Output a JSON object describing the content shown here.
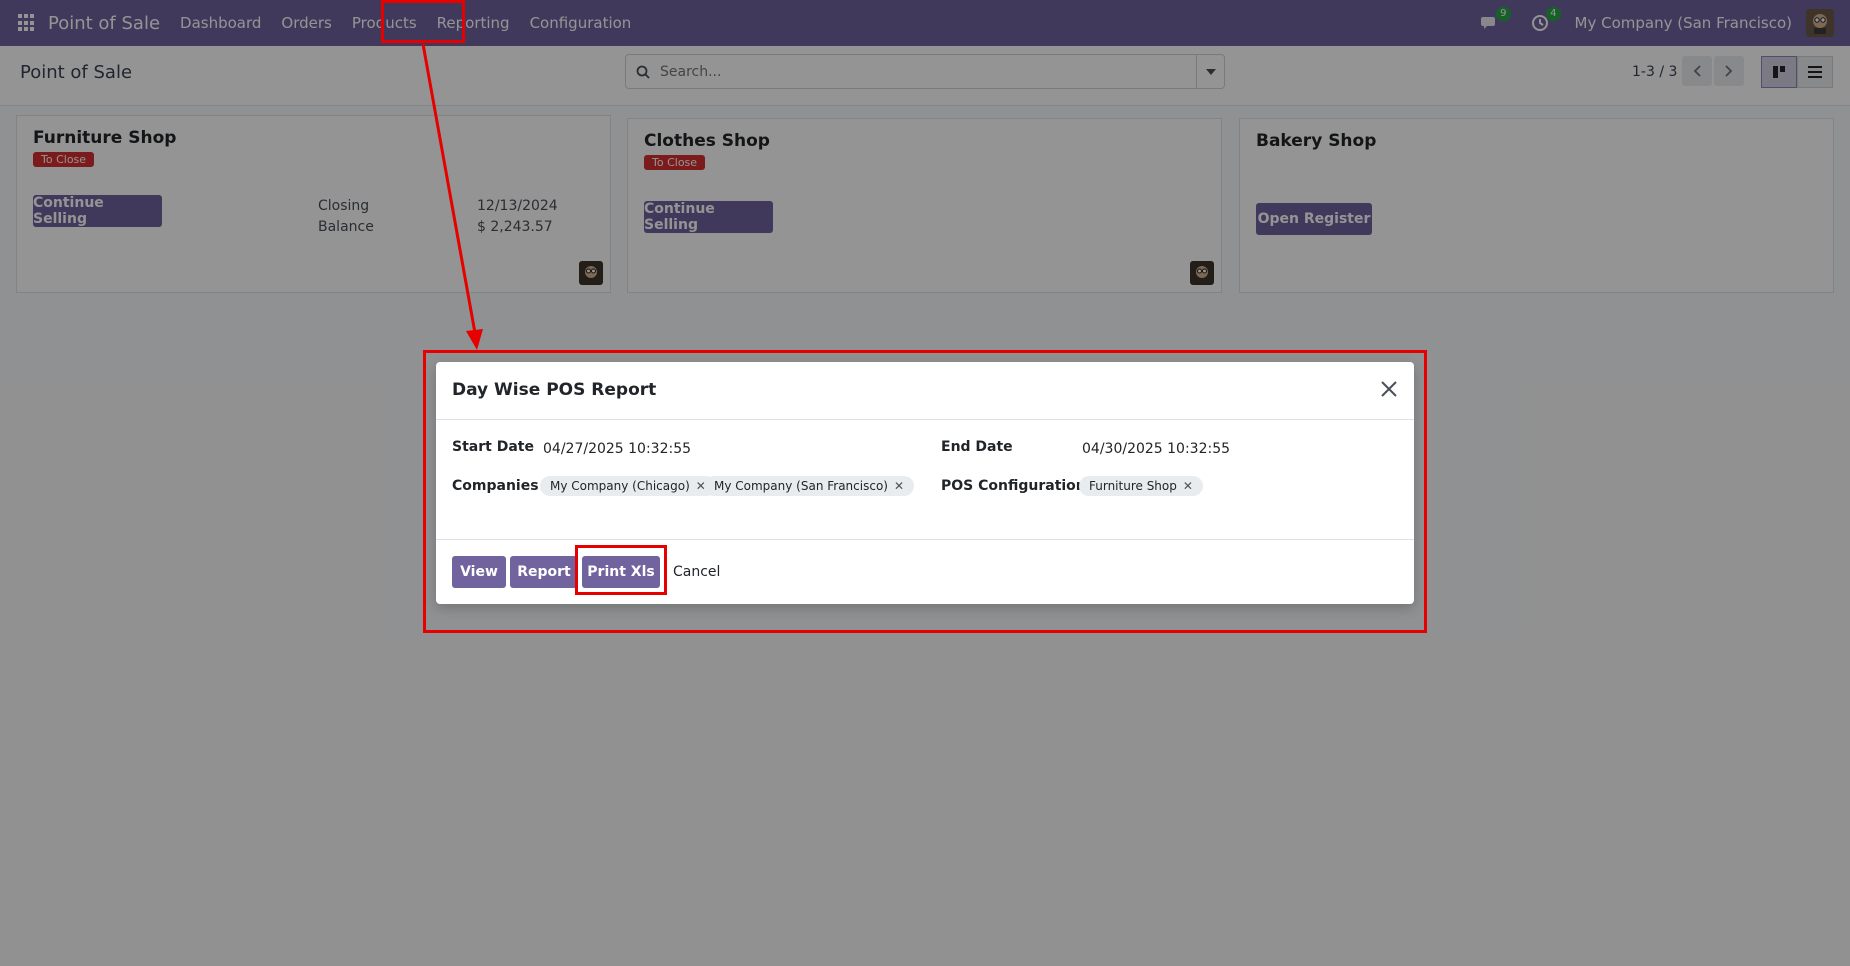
{
  "navbar": {
    "brand": "Point of Sale",
    "menu": [
      "Dashboard",
      "Orders",
      "Products",
      "Reporting",
      "Configuration"
    ],
    "messages_count": "9",
    "activities_count": "4",
    "company": "My Company (San Francisco)"
  },
  "control_panel": {
    "breadcrumb": "Point of Sale",
    "search_placeholder": "Search...",
    "pager": "1-3 / 3"
  },
  "cards": [
    {
      "title": "Furniture Shop",
      "status": "To Close",
      "button": "Continue Selling",
      "closing_label": "Closing",
      "closing_value": "12/13/2024",
      "balance_label": "Balance",
      "balance_value": "$ 2,243.57"
    },
    {
      "title": "Clothes Shop",
      "status": "To Close",
      "button": "Continue Selling"
    },
    {
      "title": "Bakery Shop",
      "button": "Open Register"
    }
  ],
  "modal": {
    "title": "Day Wise POS Report",
    "start_date_label": "Start Date",
    "start_date": "04/27/2025 10:32:55",
    "end_date_label": "End Date",
    "end_date": "04/30/2025 10:32:55",
    "companies_label": "Companies",
    "companies": [
      "My Company (Chicago)",
      "My Company (San Francisco)"
    ],
    "pos_config_label": "POS Configuration",
    "pos_configs": [
      "Furniture Shop"
    ],
    "buttons": {
      "view": "View",
      "report": "Report",
      "print_xls": "Print Xls",
      "cancel": "Cancel"
    }
  },
  "colors": {
    "brand": "#71639e",
    "status_danger": "#d63030",
    "annotation": "#e60000"
  }
}
